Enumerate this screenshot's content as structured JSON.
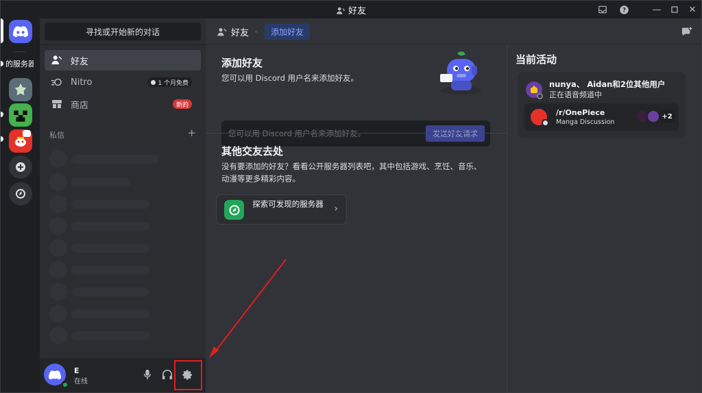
{
  "window": {
    "title": "好友"
  },
  "rail": {
    "servers": [
      {
        "name": "home",
        "color": "#5865f2"
      },
      {
        "name": "server-partial-text",
        "label": "的服务器"
      },
      {
        "name": "server-emblem"
      },
      {
        "name": "server-creeper"
      },
      {
        "name": "server-reddit"
      },
      {
        "name": "add-server"
      },
      {
        "name": "discover"
      }
    ]
  },
  "sidebar": {
    "search_label": "寻找或开始新的对话",
    "nav": [
      {
        "label": "好友"
      },
      {
        "label": "Nitro",
        "badge": "1 个月免费"
      },
      {
        "label": "商店",
        "badge": "新的"
      }
    ],
    "dm_header": "私信",
    "dm_add": "+"
  },
  "user": {
    "name": "E",
    "status": "在线"
  },
  "header": {
    "friends_label": "好友",
    "add_friend_label": "添加好友"
  },
  "main": {
    "add_title": "添加好友",
    "add_desc": "您可以用 Discord 用户名来添加好友。",
    "add_placeholder": "您可以用 Discord 用户名来添加好友。",
    "send_label": "发送好友请求",
    "other_title": "其他交友去处",
    "other_desc": "没有要添加的好友？看看公开服务器列表吧，其中包括游戏、烹饪、音乐、动漫等更多精彩内容。",
    "explore_label": "探索可发现的服务器"
  },
  "activity": {
    "title": "当前活动",
    "card": {
      "names": "nunya、 Aidan和2位其他用户",
      "status": "正在语音频道中",
      "channel": "/r/OnePiece",
      "category": "Manga Discussion",
      "more": "+2"
    }
  },
  "colors": {
    "accent": "#5865f2",
    "online": "#23a55a",
    "badge_red": "#da373c",
    "annotation": "#e01e1e"
  }
}
